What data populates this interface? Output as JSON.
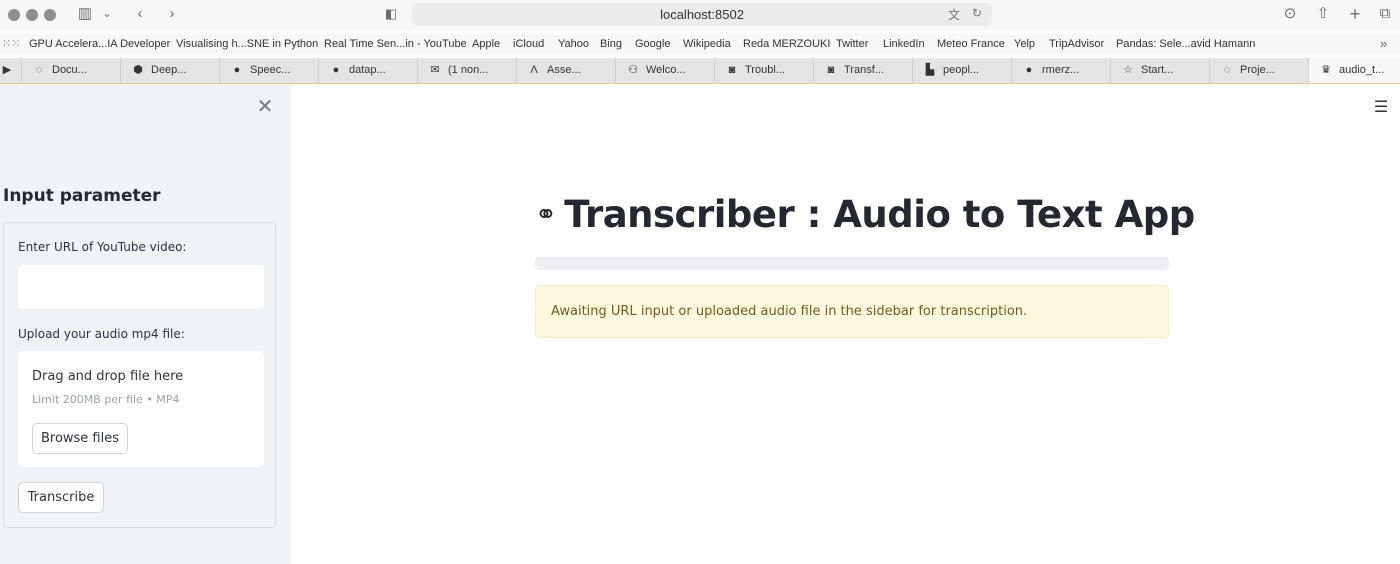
{
  "browser": {
    "url": "localhost:8502",
    "bookmarks": [
      "GPU Accelera...IA Developer",
      "Visualising h...SNE in Python",
      "Real Time Sen...in - YouTube",
      "Apple",
      "iCloud",
      "Yahoo",
      "Bing",
      "Google",
      "Wikipedia",
      "Reda MERZOUKI",
      "Twitter",
      "LinkedIn",
      "Meteo France",
      "Yelp",
      "TripAdvisor",
      "Pandas: Sele...avid Hamann"
    ],
    "tabs": [
      {
        "label": "",
        "icon": "youtube-icon"
      },
      {
        "label": "Docu...",
        "icon": "loading-icon"
      },
      {
        "label": "Deep...",
        "icon": "cube-icon"
      },
      {
        "label": "Speec...",
        "icon": "github-icon"
      },
      {
        "label": "datap...",
        "icon": "github-icon"
      },
      {
        "label": "(1 non...",
        "icon": "mail-icon"
      },
      {
        "label": "Asse...",
        "icon": "a-icon"
      },
      {
        "label": "Welco...",
        "icon": "python-icon"
      },
      {
        "label": "Troubl...",
        "icon": "medium-icon"
      },
      {
        "label": "Transf...",
        "icon": "medium-icon"
      },
      {
        "label": "peopl...",
        "icon": "unsplash-icon"
      },
      {
        "label": "rmerz...",
        "icon": "github-icon"
      },
      {
        "label": "Start...",
        "icon": "star-icon"
      },
      {
        "label": "Proje...",
        "icon": "loading-icon"
      },
      {
        "label": "audio_t...",
        "icon": "streamlit-icon"
      }
    ]
  },
  "sidebar": {
    "title": "Input parameter",
    "url_label": "Enter URL of YouTube video:",
    "url_value": "",
    "upload_label": "Upload your audio mp4 file:",
    "dropzone_text": "Drag and drop file here",
    "dropzone_limit": "Limit 200MB per file • MP4",
    "browse_label": "Browse files",
    "transcribe_label": "Transcribe"
  },
  "main": {
    "title": "Transcriber : Audio to Text App",
    "title_icon": "link-icon",
    "progress": 0,
    "info_message": "Awaiting URL input or uploaded audio file in the sidebar for transcription."
  }
}
